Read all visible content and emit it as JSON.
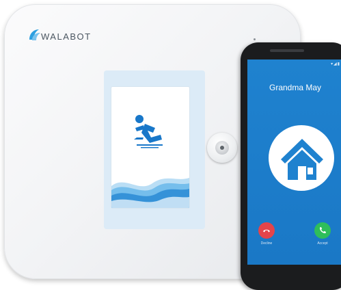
{
  "device": {
    "logo_text": "WALABOT",
    "screen_icon": "person-falling-icon",
    "wave_colors": [
      "#1a7fd0",
      "#5eb3e8",
      "#a9d6f2"
    ]
  },
  "phone": {
    "status_icons": "▾◢▮",
    "caller_name": "Grandma May",
    "avatar_icon": "home-icon",
    "decline_label": "Decline",
    "accept_label": "Accept",
    "screen_color": "#1f82cf",
    "decline_color": "#e4444a",
    "accept_color": "#2fbe5a"
  }
}
